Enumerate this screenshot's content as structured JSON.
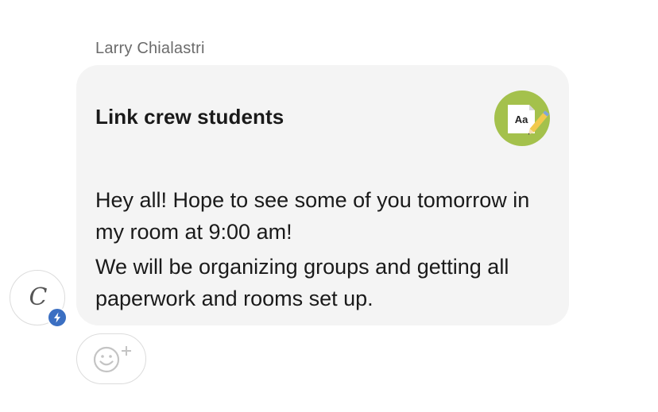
{
  "message": {
    "sender_name": "Larry Chialastri",
    "title": "Link crew students",
    "post_type_icon": "document-pencil-icon",
    "post_type_label": "Aa",
    "body_paragraphs": [
      "Hey all!  Hope to see some of you tomorrow in my room at 9:00 am!",
      "We will be organizing groups and getting all paperwork and rooms set up."
    ]
  },
  "avatar": {
    "initial": "C",
    "badge_icon": "lightning-bolt-icon"
  },
  "reaction": {
    "icon": "add-emoji-reaction-icon"
  },
  "colors": {
    "bubble_background": "#f4f4f4",
    "badge_green": "#a4c14c",
    "bolt_blue": "#3b6fc2",
    "sender_name_gray": "#6b6b6b",
    "text_dark": "#1a1a1a"
  }
}
